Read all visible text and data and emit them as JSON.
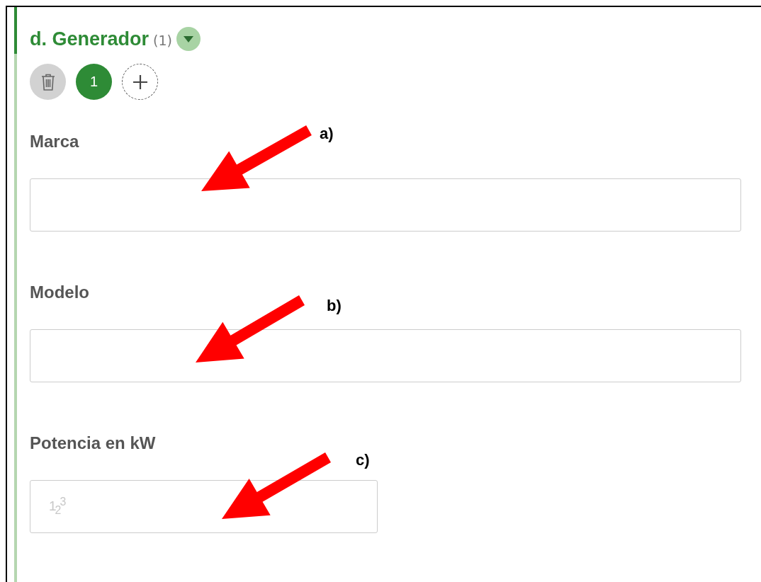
{
  "section": {
    "title": "d. Generador",
    "count": "(1)",
    "expanded": true
  },
  "entries": [
    {
      "label": "1",
      "selected": true
    }
  ],
  "fields": [
    {
      "kind": "text",
      "label": "Marca"
    },
    {
      "kind": "text",
      "label": "Modelo"
    },
    {
      "kind": "number",
      "label": "Potencia en kW",
      "hint": "1$_{2}$$^{3}$"
    }
  ],
  "annotations": [
    {
      "label": "a)"
    },
    {
      "label": "b)"
    },
    {
      "label": "c)"
    }
  ]
}
